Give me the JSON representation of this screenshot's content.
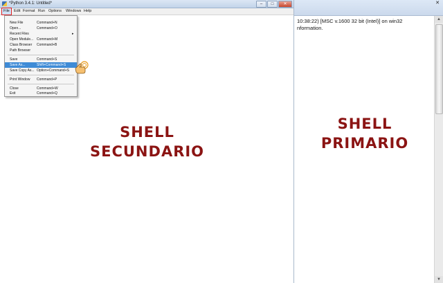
{
  "left_window": {
    "title": "*Python 3.4.1: Untitled*",
    "controls": {
      "minimize": "–",
      "maximize": "□",
      "close": "✕"
    },
    "menubar": [
      "File",
      "Edit",
      "Format",
      "Run",
      "Options",
      "Windows",
      "Help"
    ],
    "file_menu": [
      {
        "label": "New File",
        "shortcut": "Command+N"
      },
      {
        "label": "Open...",
        "shortcut": "Command+O"
      },
      {
        "label": "Recent Files",
        "shortcut": "",
        "arrow": "▸"
      },
      {
        "label": "Open Module...",
        "shortcut": "Command+M"
      },
      {
        "label": "Class Browser",
        "shortcut": "Command+B"
      },
      {
        "label": "Path Browser",
        "shortcut": ""
      },
      {
        "label": "Save",
        "shortcut": "Command+S"
      },
      {
        "label": "Save As...",
        "shortcut": "Shift+Command+S"
      },
      {
        "label": "Save Copy As...",
        "shortcut": "Option+Command+S"
      },
      {
        "label": "Print Window",
        "shortcut": "Command+P"
      },
      {
        "label": "Close",
        "shortcut": "Command+W"
      },
      {
        "label": "Exit",
        "shortcut": "Command+Q"
      }
    ],
    "highlighted_item": "Save As...",
    "overlay_label": [
      "SHELL",
      "SECUNDARIO"
    ]
  },
  "right_window": {
    "close": "✕",
    "shell_lines": [
      "10:38:22) [MSC v.1600 32 bit (Intel)] on win32",
      "nformation."
    ],
    "overlay_label": [
      "SHELL",
      "PRIMARIO"
    ]
  },
  "colors": {
    "overlay_text": "#8b1413",
    "highlight": "#3f8bd6",
    "file_menu_outline": "#e02020"
  }
}
